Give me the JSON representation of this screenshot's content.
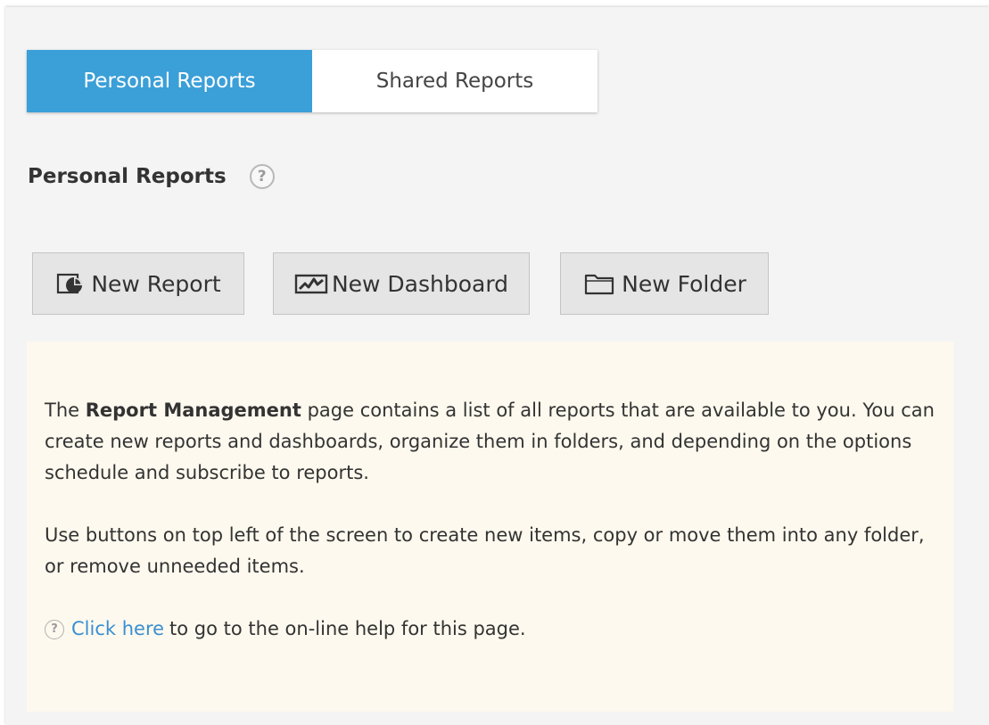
{
  "tabs": [
    {
      "label": "Personal Reports",
      "active": true
    },
    {
      "label": "Shared Reports",
      "active": false
    }
  ],
  "section": {
    "title": "Personal Reports",
    "help_icon": "question-circle-icon"
  },
  "buttons": {
    "new_report": "New Report",
    "new_dashboard": "New Dashboard",
    "new_folder": "New Folder"
  },
  "info": {
    "p1_before": "The ",
    "p1_bold": "Report Management",
    "p1_after": " page contains a list of all reports that are available to you. You can create new reports and dashboards, organize them in folders, and depending on the options schedule and subscribe to reports.",
    "p2": "Use buttons on top left of the screen to create new items, copy or move them into any folder, or remove unneeded items.",
    "link_text": "Click here",
    "link_after": "to go to the on-line help for this page."
  },
  "colors": {
    "active_tab": "#3b9fd8",
    "info_background": "#fdf9ee",
    "link": "#3b8fd0"
  }
}
